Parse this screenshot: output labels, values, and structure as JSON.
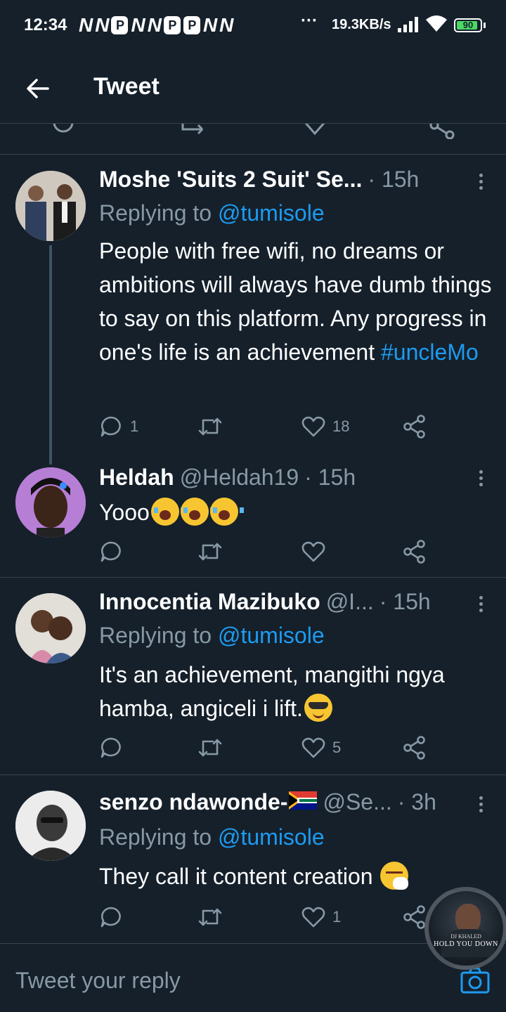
{
  "status_bar": {
    "time": "12:34",
    "notification_icons": [
      "N",
      "N",
      "P",
      "N",
      "N",
      "P",
      "P",
      "N",
      "N"
    ],
    "overflow": "···",
    "net_speed": "19.3KB/s",
    "battery": "90",
    "battery_fraction": 0.9
  },
  "header": {
    "title": "Tweet"
  },
  "tweets": [
    {
      "name": "Moshe 'Suits 2 Suit' Se...",
      "handle": "",
      "time": "· 15h",
      "replying_label": "Replying to",
      "replying_to": "@tumisole",
      "text": "People with free wifi, no dreams or ambitions will always have dumb things to say on this platform. Any progress in one's life is an achievement ",
      "hashtag": "#uncleMo",
      "replies": "1",
      "retweets": "",
      "likes": "18"
    },
    {
      "name": "Heldah",
      "handle": "@Heldah19",
      "time": "· 15h",
      "text": "Yooo",
      "emojis": [
        "loudly-crying-face",
        "loudly-crying-face",
        "loudly-crying-face"
      ],
      "replies": "",
      "retweets": "",
      "likes": ""
    },
    {
      "name": "Innocentia Mazibuko",
      "handle": "@I...",
      "time": "· 15h",
      "replying_label": "Replying to",
      "replying_to": "@tumisole",
      "text": "It's an achievement, mangithi ngya hamba, angiceli i lift.",
      "emoji": "smiling-face-with-sunglasses",
      "replies": "",
      "retweets": "",
      "likes": "5"
    },
    {
      "name": "senzo ndawonde-",
      "name_flag": "south-africa-flag",
      "handle": "@Se...",
      "time": "· 3h",
      "replying_label": "Replying to",
      "replying_to": "@tumisole",
      "text": "They call it content creation ",
      "emoji": "sneezing-face",
      "replies": "",
      "retweets": "",
      "likes": "1"
    }
  ],
  "compose": {
    "placeholder": "Tweet your reply"
  },
  "floating_media": {
    "line1": "DJ KHALED",
    "line2": "HOLD YOU DOWN"
  },
  "colors": {
    "background": "#15202b",
    "accent": "#1d9bf0",
    "muted": "#8899a6",
    "divider": "#38444d"
  }
}
